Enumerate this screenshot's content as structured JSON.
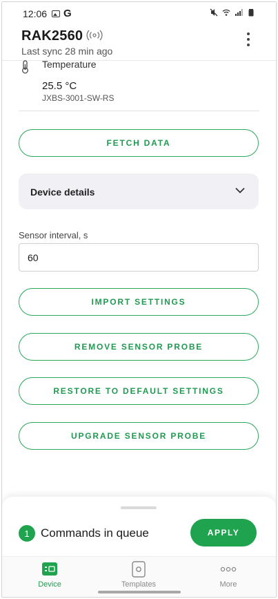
{
  "status_bar": {
    "time": "12:06",
    "g_label": "G"
  },
  "header": {
    "title": "RAK2560",
    "subtitle": "Last sync 28 min ago"
  },
  "sensor": {
    "name": "Temperature",
    "value": "25.5 °C",
    "model": "JXBS-3001-SW-RS"
  },
  "buttons": {
    "fetch": "FETCH DATA",
    "import": "IMPORT SETTINGS",
    "remove": "REMOVE SENSOR PROBE",
    "restore": "RESTORE TO DEFAULT SETTINGS",
    "upgrade": "UPGRADE SENSOR PROBE"
  },
  "device_details": {
    "label": "Device details",
    "expanded": false
  },
  "interval": {
    "label": "Sensor interval, s",
    "value": "60"
  },
  "queue": {
    "count": "1",
    "label": "Commands in queue",
    "apply": "APPLY"
  },
  "nav": {
    "items": [
      {
        "label": "Device",
        "icon": "device-icon",
        "active": true
      },
      {
        "label": "Templates",
        "icon": "templates-icon",
        "active": false
      },
      {
        "label": "More",
        "icon": "more-icon",
        "active": false
      }
    ]
  },
  "colors": {
    "accent": "#1fa34f",
    "details_bg": "#f1f1f5"
  }
}
